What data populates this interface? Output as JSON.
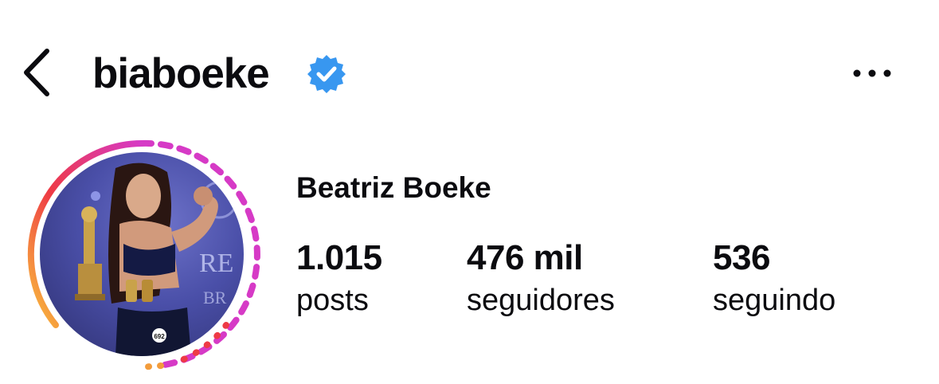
{
  "header": {
    "username": "biaboeke",
    "back_icon": "chevron-left-icon",
    "verified_icon": "verified-badge-icon",
    "more_icon": "more-horizontal-icon"
  },
  "profile": {
    "full_name": "Beatriz Boeke",
    "avatar_story_ring": true,
    "avatar_badge_number": "692"
  },
  "stats": [
    {
      "value": "1.015",
      "label": "posts"
    },
    {
      "value": "476 mil",
      "label": "seguidores"
    },
    {
      "value": "536",
      "label": "seguindo"
    }
  ],
  "colors": {
    "text": "#0b0b0f",
    "verified": "#3897f0",
    "ring_start": "#f9c23c",
    "ring_mid": "#ee3a45",
    "ring_end": "#d63ac6"
  }
}
